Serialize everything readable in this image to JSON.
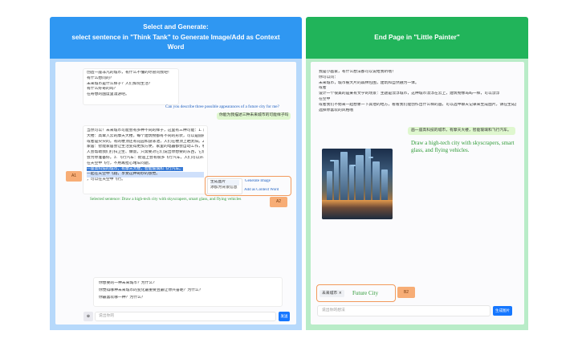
{
  "left_panel": {
    "title_line1": "Select and Generate:",
    "title_line2": "select sentence in \"Think Tank\" to Generate Image/Add as Context",
    "title_line3": "Word",
    "chat": {
      "first_bubble": [
        "创造一座非凡的城市，有什么不懂的尽管问我吧！",
        "有什么想问的？",
        "未来城市是什么样子？人们如何生活？",
        "有什么好奇的吗？",
        "在奇想的国度里漫游吧。"
      ],
      "question_en": "Can you describe three possible appearances of a future city for me?",
      "question_cn": "你能为我描述三种未来城市的可能样子吗",
      "answer_lines": [
        "当然可以！未来城市可能会有多种不同的样子，这里有三种可能：1. 摩天",
        "大楼：高耸入云的摩天大楼，每个建筑物都有不同的形状，可以是圆形的",
        "或者是尖尖的。有的楼顶还有花园和游泳池，人们在楼顶上晒太阳。2. 智能",
        "家居：智能家居会让生活变得更加方便，家里的电器都会自动工作，机器",
        "人会帮助我们打扫卫生、做饭，只需要对它们说出你想要的东西，它们就",
        "会为你准备好。3. 飞行汽车：街道上会有很多飞行汽车，人们可以开着车",
        "在天空中飞行，不用再担心堵车问题，"
      ],
      "selected_hl_cn": "一座高科技的城市，有摩天大楼，智能玻璃和飞行汽车。",
      "answer_tail": "一起在天空中飞翔，享受这种奇妙的感觉。",
      "answer_tail2": "，可以在天空中飞行。",
      "selected_sentence_en": "Selected sentence: Draw a high-tech city with skyscrapers, smart glass, and flying vehicles"
    },
    "context_menu": {
      "gen_cn": "生成图片",
      "add_cn": "添加为背景信息",
      "gen_en": "Generate Image",
      "add_en": "Add as Context Word"
    },
    "badge_a1": "A1",
    "badge_a2": "A2",
    "suggestions": [
      "你想要的一种未来城市？为什么？",
      "你觉得哪种未来城市的变化最重要且最让你兴奋呢？为什么？",
      "你最喜欢哪一种？为什么？"
    ],
    "input_placeholder": "说出你的",
    "send_label": "发送"
  },
  "right_panel": {
    "title": "End Page in \"Little Painter\"",
    "intro_lines": [
      "我是小画家，有什么想法都可以说给我听哦！",
      "你可以问：",
      "未来城市，城市被大片的森林包围，建筑和自然融为一体。",
      "或者",
      "设计一个很美的是某有文学的场景：主题是漂浮城市，这种城市漂浮在云上，建筑物像岛屿一样，可以漂浮",
      "在空中",
      "或者我们不妨来一起想象一下其他的地方，看看我们能创作出什么样的画，可以选中聊天记录来生成图片，请在生成图片时",
      "选择你喜欢的风格哦"
    ],
    "user_prompt_cn": "画一座高科技的城市，有摩天大楼，智能玻璃和飞行汽车。",
    "image_caption_en": "Draw a high-tech city with skyscrapers, smart glass, and flying vehicles.",
    "context_tag": "未来城市",
    "context_tag_close": "×",
    "context_en": "Future City",
    "badge_b2": "B2",
    "input_placeholder": "说出你的想法",
    "send_label": "生成图片"
  }
}
